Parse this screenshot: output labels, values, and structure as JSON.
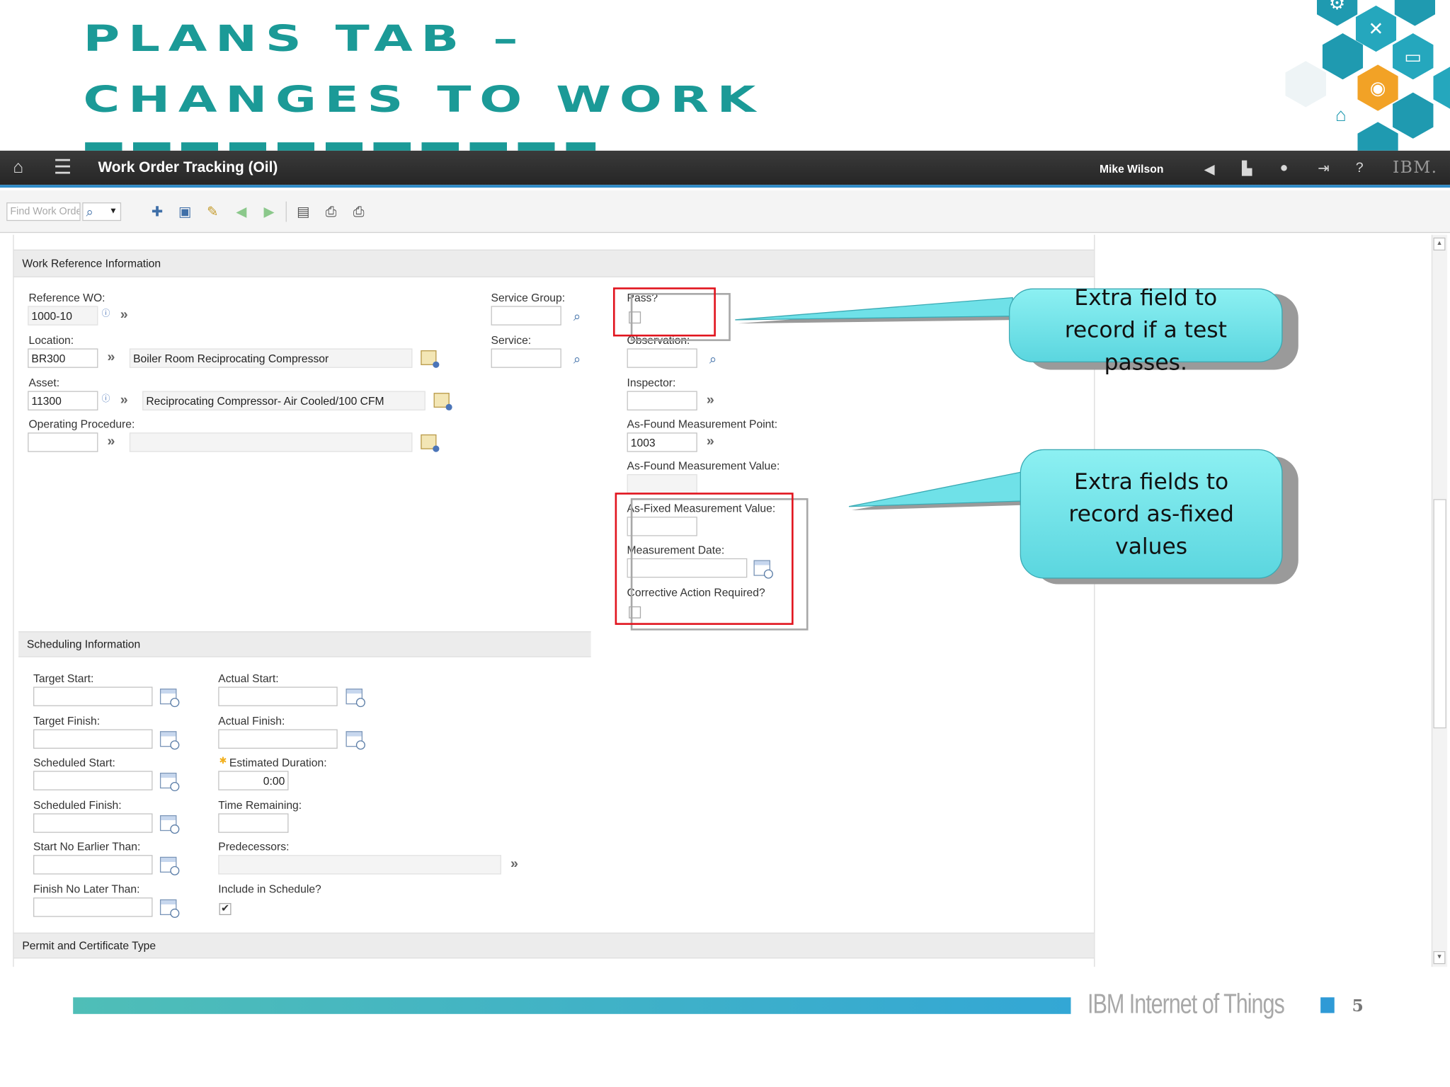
{
  "slide": {
    "title_lines": [
      "PLANS TAB –",
      "CHANGES TO WORK"
    ],
    "footer_text": "IBM Internet of Things",
    "page_number": "5",
    "colors": {
      "title": "#1b9a97",
      "callout": "#6fe1e8",
      "highlight": "#e1141e",
      "footer_bar": "#33a7d5"
    }
  },
  "header": {
    "app_title": "Work Order Tracking (Oil)",
    "user_name": "Mike Wilson",
    "brand": "IBM.",
    "left_icons": [
      "home-icon",
      "menu-icon"
    ],
    "right_icons": [
      "megaphone-icon",
      "chart-icon",
      "profile-icon",
      "logout-icon",
      "help-icon"
    ]
  },
  "toolbar": {
    "find_placeholder": "Find Work Order",
    "icons": [
      "search-icon",
      "dropdown-icon",
      "new-record-icon",
      "save-icon",
      "edit-icon",
      "previous-icon",
      "next-icon",
      "report-icon",
      "print-icon",
      "print-attachments-icon"
    ]
  },
  "work_reference": {
    "section_title": "Work Reference Information",
    "reference_wo": {
      "label": "Reference WO:",
      "value": "1000-10"
    },
    "location": {
      "label": "Location:",
      "value": "BR300",
      "description": "Boiler Room Reciprocating Compressor"
    },
    "asset": {
      "label": "Asset:",
      "value": "11300",
      "description": "Reciprocating Compressor- Air Cooled/100 CFM"
    },
    "operating_procedure": {
      "label": "Operating Procedure:",
      "value": "",
      "description": ""
    },
    "service_group": {
      "label": "Service Group:",
      "value": ""
    },
    "service": {
      "label": "Service:",
      "value": ""
    },
    "pass": {
      "label": "Pass?",
      "checked": false
    },
    "observation": {
      "label": "Observation:",
      "value": ""
    },
    "inspector": {
      "label": "Inspector:",
      "value": ""
    },
    "as_found_point": {
      "label": "As-Found Measurement Point:",
      "value": "1003"
    },
    "as_found_value": {
      "label": "As-Found Measurement Value:",
      "value": ""
    },
    "as_fixed_value": {
      "label": "As-Fixed Measurement Value:",
      "value": ""
    },
    "measurement_date": {
      "label": "Measurement Date:",
      "value": ""
    },
    "corrective_action": {
      "label": "Corrective Action Required?",
      "checked": false
    }
  },
  "scheduling": {
    "section_title": "Scheduling Information",
    "target_start": {
      "label": "Target Start:",
      "value": ""
    },
    "target_finish": {
      "label": "Target Finish:",
      "value": ""
    },
    "scheduled_start": {
      "label": "Scheduled Start:",
      "value": ""
    },
    "scheduled_finish": {
      "label": "Scheduled Finish:",
      "value": ""
    },
    "start_no_earlier": {
      "label": "Start No Earlier Than:",
      "value": ""
    },
    "finish_no_later": {
      "label": "Finish No Later Than:",
      "value": ""
    },
    "actual_start": {
      "label": "Actual Start:",
      "value": ""
    },
    "actual_finish": {
      "label": "Actual Finish:",
      "value": ""
    },
    "estimated_duration": {
      "label": "Estimated Duration:",
      "value": "0:00"
    },
    "time_remaining": {
      "label": "Time Remaining:",
      "value": ""
    },
    "predecessors": {
      "label": "Predecessors:",
      "value": ""
    },
    "include_in_schedule": {
      "label": "Include in Schedule?",
      "checked": true
    }
  },
  "permit": {
    "section_title": "Permit and Certificate Type"
  },
  "callouts": {
    "pass_field": "Extra field to record if a test passes.",
    "as_fixed_fields": "Extra fields to record as-fixed values"
  }
}
